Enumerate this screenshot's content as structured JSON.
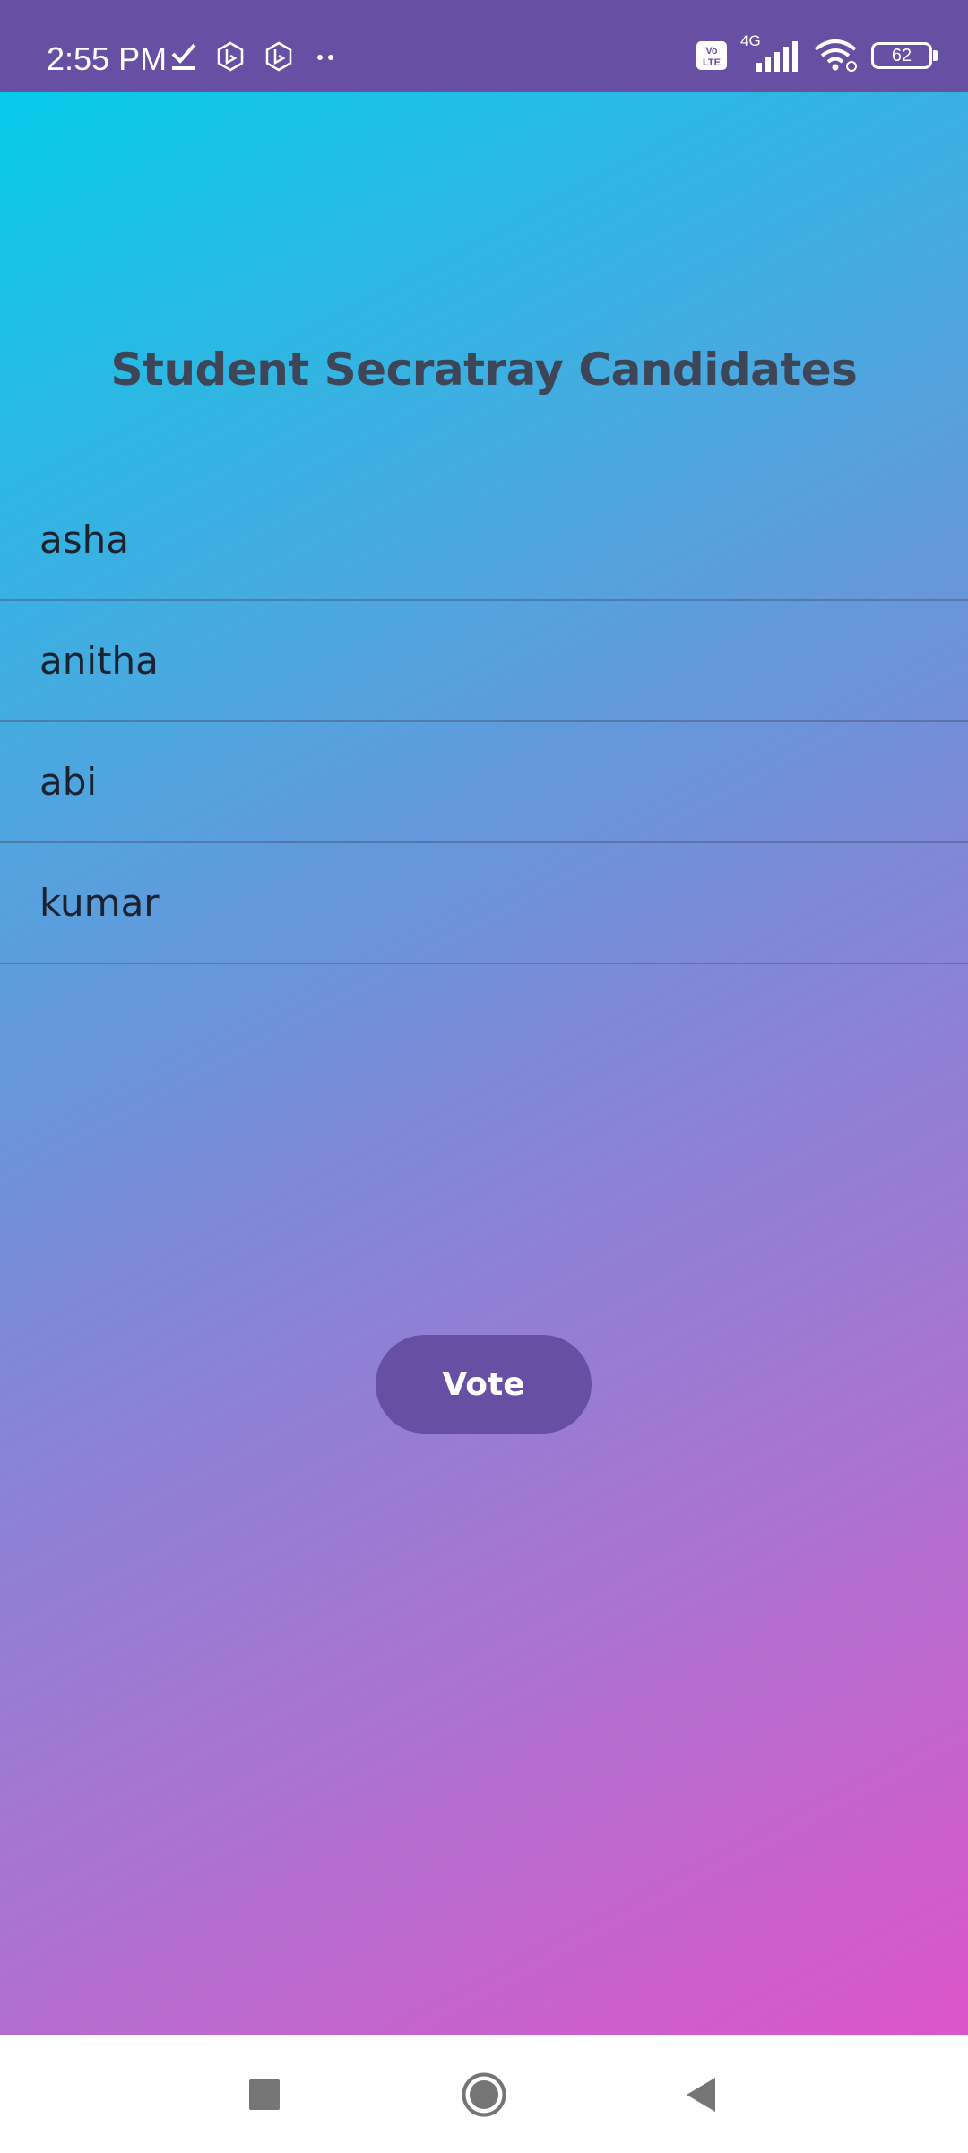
{
  "status_bar": {
    "time": "2:55 PM",
    "network_type": "4G",
    "volte_label": "Vo LTE",
    "battery_level": "62",
    "icons": [
      "check-icon",
      "bing-icon",
      "bing-icon",
      "more-dots-icon",
      "volte-icon",
      "signal-icon",
      "wifi-icon",
      "battery-icon"
    ]
  },
  "main": {
    "title": "Student Secratray Candidates",
    "candidates": [
      {
        "name": "asha"
      },
      {
        "name": "anitha"
      },
      {
        "name": "abi"
      },
      {
        "name": "kumar"
      }
    ],
    "vote_button_label": "Vote"
  },
  "colors": {
    "accent": "#6750a4",
    "gradient_start": "#06cbe8",
    "gradient_end": "#dc55c8",
    "title_text": "#3d4556"
  },
  "nav_bar": {
    "icons": [
      "recents-icon",
      "home-icon",
      "back-icon"
    ]
  }
}
